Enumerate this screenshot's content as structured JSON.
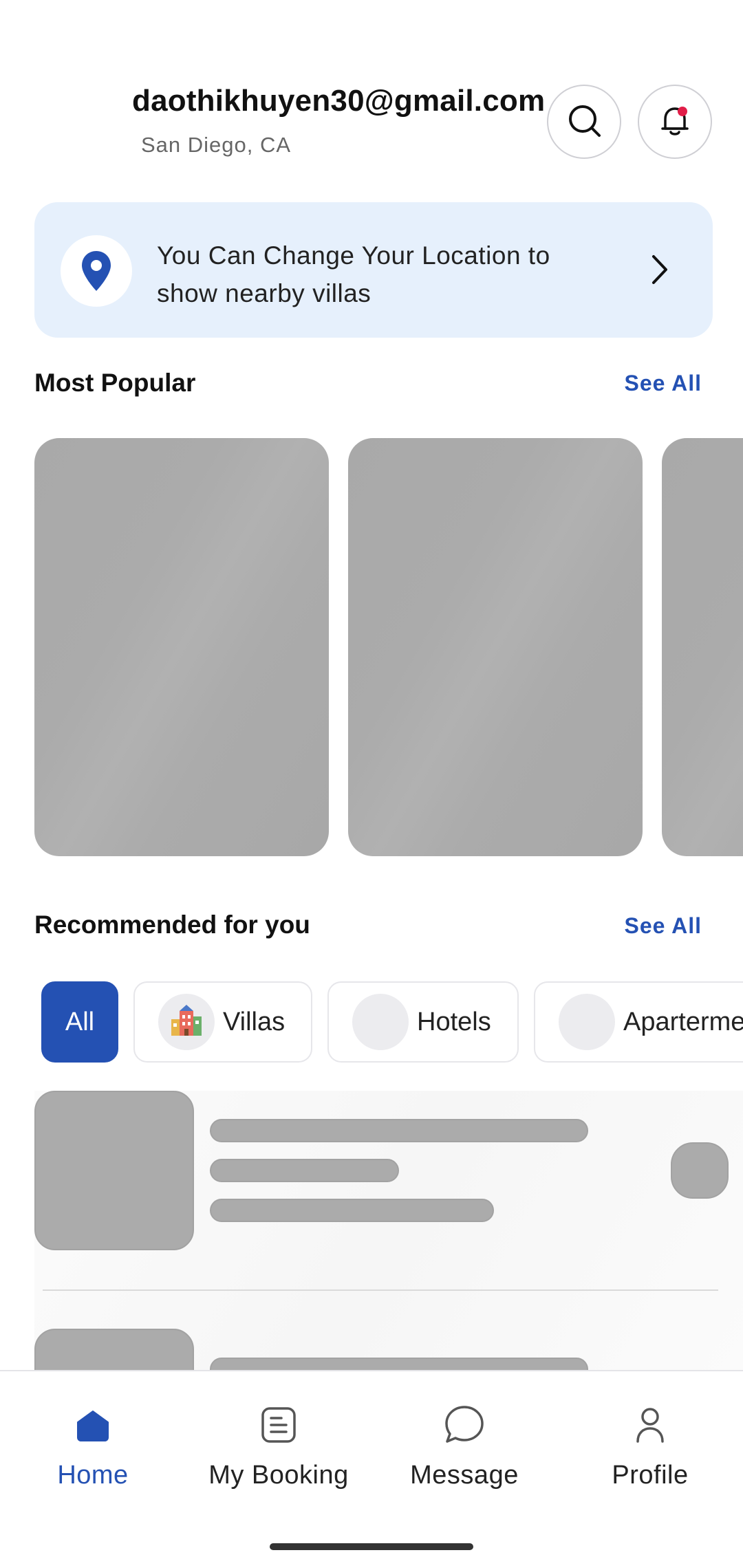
{
  "header": {
    "email": "daothikhuyen30@gmail.com",
    "location": "San Diego, CA"
  },
  "banner": {
    "text": "You Can Change Your Location to\n show nearby villas"
  },
  "popular": {
    "title": "Most Popular",
    "see_all": "See All"
  },
  "recommended": {
    "title": "Recommended for you",
    "see_all": "See All",
    "chips": [
      {
        "label": "All",
        "selected": true
      },
      {
        "label": "Villas",
        "icon": "villas-icon"
      },
      {
        "label": "Hotels",
        "icon": "hotels-icon"
      },
      {
        "label": "Aparterme",
        "icon": "apartments-icon"
      }
    ]
  },
  "nav": {
    "items": [
      {
        "label": "Home",
        "icon": "home-icon",
        "active": true
      },
      {
        "label": "My Booking",
        "icon": "booking-icon"
      },
      {
        "label": "Message",
        "icon": "message-icon"
      },
      {
        "label": "Profile",
        "icon": "profile-icon"
      }
    ]
  },
  "colors": {
    "accent": "#2451b3",
    "banner_bg": "#e6f0fc",
    "skeleton": "#ababab",
    "notification_dot": "#e11d48"
  }
}
